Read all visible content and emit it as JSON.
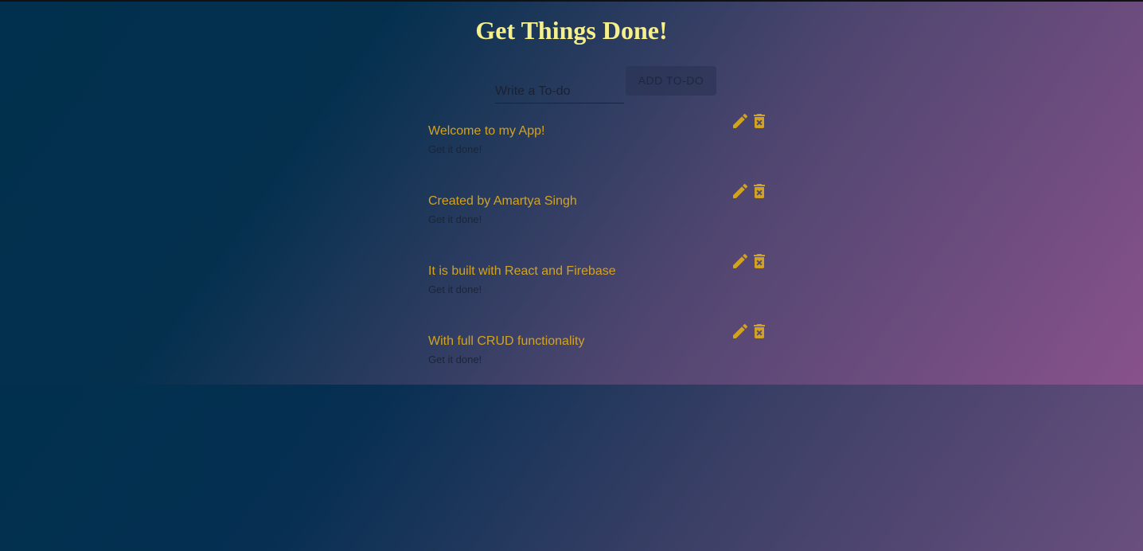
{
  "app": {
    "title": "Get Things Done!"
  },
  "form": {
    "placeholder": "Write a To-do",
    "value": "",
    "add_label": "ADD TO-DO"
  },
  "todos": [
    {
      "title": "Welcome to my App!",
      "subtitle": "Get it done!"
    },
    {
      "title": "Created by Amartya Singh",
      "subtitle": "Get it done!"
    },
    {
      "title": "It is built with React and Firebase",
      "subtitle": "Get it done!"
    },
    {
      "title": "With full CRUD functionality",
      "subtitle": "Get it done!"
    }
  ],
  "icons": {
    "edit": "pencil-icon",
    "delete": "trash-icon"
  },
  "colors": {
    "heading": "#f5ef8c",
    "accent": "#d2a322",
    "text_dark": "#1c2535"
  }
}
